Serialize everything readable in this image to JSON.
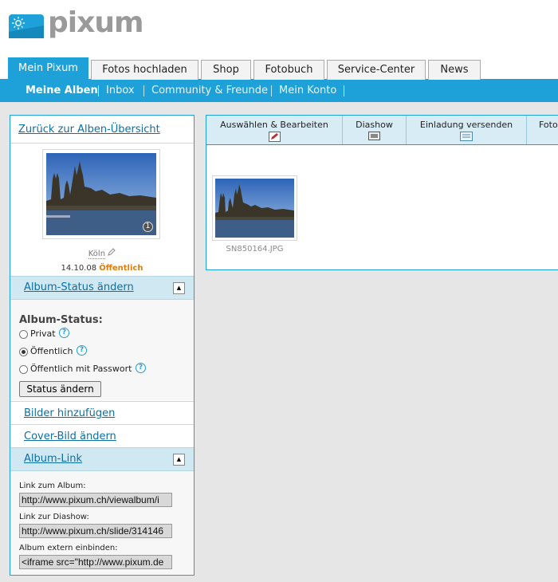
{
  "brand": {
    "name": "pixum"
  },
  "tabs": [
    {
      "label": "Mein Pixum",
      "active": true
    },
    {
      "label": "Fotos hochladen"
    },
    {
      "label": "Shop"
    },
    {
      "label": "Fotobuch"
    },
    {
      "label": "Service-Center"
    },
    {
      "label": "News"
    }
  ],
  "subnav": [
    {
      "label": "Meine Alben",
      "active": true
    },
    {
      "label": "Inbox"
    },
    {
      "label": "Community & Freunde"
    },
    {
      "label": "Mein Konto"
    }
  ],
  "sidebar": {
    "back_link": "Zurück zur Alben-Übersicht",
    "cover_count": "1",
    "album_name": "Köln",
    "album_date": "14.10.08",
    "album_status": "Öffentlich",
    "status_section": {
      "title": "Album-Status ändern",
      "heading": "Album-Status:",
      "options": [
        {
          "label": "Privat",
          "checked": false
        },
        {
          "label": "Öffentlich",
          "checked": true
        },
        {
          "label": "Öffentlich mit Passwort",
          "checked": false
        }
      ],
      "button": "Status ändern",
      "help_icon": "?"
    },
    "add_pictures": "Bilder hinzufügen",
    "change_cover": "Cover-Bild ändern",
    "album_link_section": {
      "title": "Album-Link",
      "album_label": "Link zum Album:",
      "album_url": "http://www.pixum.ch/viewalbum/i",
      "slideshow_label": "Link zur Diashow:",
      "slideshow_url": "http://www.pixum.ch/slide/314146",
      "embed_label": "Album extern einbinden:",
      "embed_code": "<iframe src=\"http://www.pixum.de"
    }
  },
  "toolbar": [
    {
      "label": "Auswählen & Bearbeiten",
      "icon": "edit-icon"
    },
    {
      "label": "Diashow",
      "icon": "slideshow-icon"
    },
    {
      "label": "Einladung versenden",
      "icon": "invitation-icon"
    },
    {
      "label": "Fotos",
      "icon": "photos-icon"
    }
  ],
  "photos": [
    {
      "filename": "SN850164.JPG"
    }
  ],
  "colors": {
    "accent": "#1da1d8",
    "status": "#e07c10",
    "link": "#0d6fa5"
  }
}
